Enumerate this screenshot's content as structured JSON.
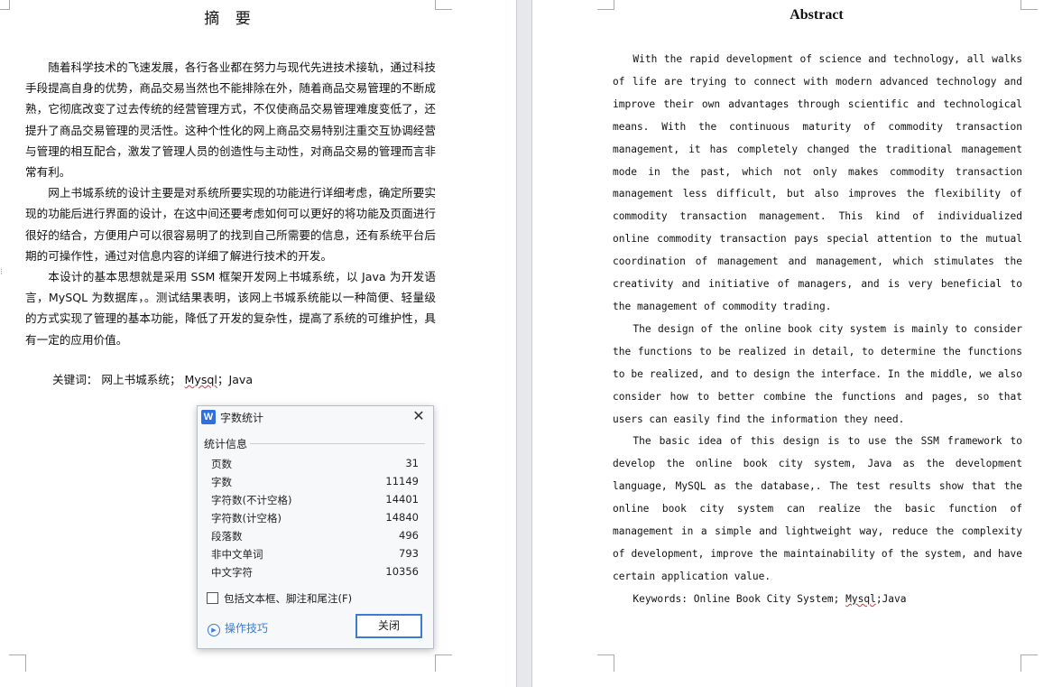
{
  "left_page": {
    "title": "摘  要",
    "paragraphs": [
      "随着科学技术的飞速发展，各行各业都在努力与现代先进技术接轨，通过科技手段提高自身的优势，商品交易当然也不能排除在外，随着商品交易管理的不断成熟，它彻底改变了过去传统的经营管理方式，不仅使商品交易管理难度变低了，还提升了商品交易管理的灵活性。这种个性化的网上商品交易特别注重交互协调经营与管理的相互配合，激发了管理人员的创造性与主动性，对商品交易的管理而言非常有利。",
      "网上书城系统的设计主要是对系统所要实现的功能进行详细考虑，确定所要实现的功能后进行界面的设计，在这中间还要考虑如何可以更好的将功能及页面进行很好的结合，方便用户可以很容易明了的找到自己所需要的信息，还有系统平台后期的可操作性，通过对信息内容的详细了解进行技术的开发。",
      "本设计的基本思想就是采用 SSM 框架开发网上书城系统，以 Java 为开发语言，MySQL 为数据库，。测试结果表明，该网上书城系统能以一种简便、轻量级的方式实现了管理的基本功能，降低了开发的复杂性，提高了系统的可维护性，具有一定的应用价值。"
    ],
    "keywords_label": "关键词：",
    "keywords": [
      "网上书城系统；",
      "Mysql",
      "；Java"
    ]
  },
  "right_page": {
    "title": "Abstract",
    "paragraphs": [
      "With the rapid development of science and technology, all walks of life are trying to connect with modern advanced technology and improve their own advantages through scientific and technological means. With the continuous maturity of commodity transaction management, it has completely changed the traditional management mode in the past, which not only makes commodity transaction management less difficult, but also improves the flexibility of commodity transaction management. This kind of individualized online commodity transaction pays special attention to the mutual coordination of management and management, which stimulates the creativity and initiative of managers, and is very beneficial to the management of commodity trading.",
      "The design of the online book city system is mainly to consider the functions to be realized in detail, to determine the functions to be realized, and to design the interface. In the middle, we also consider how to better combine the functions and pages, so that users can easily find the information they need.",
      "The basic idea of this design is to use the SSM framework to develop the online book city system, Java as the development language, MySQL as the database,. The test results show that the online book city system can realize the basic function of management in a simple and lightweight way, reduce the complexity of development, improve the maintainability of the system, and have certain application value."
    ],
    "keywords_prefix": "Keywords: Online Book City System; ",
    "keywords_mysql": "Mysql",
    "keywords_suffix": ";Java"
  },
  "dialog": {
    "app_icon_letter": "W",
    "title": "字数统计",
    "group_label": "统计信息",
    "stats": [
      {
        "label": "页数",
        "value": "31"
      },
      {
        "label": "字数",
        "value": "11149"
      },
      {
        "label": "字符数(不计空格)",
        "value": "14401"
      },
      {
        "label": "字符数(计空格)",
        "value": "14840"
      },
      {
        "label": "段落数",
        "value": "496"
      },
      {
        "label": "非中文单词",
        "value": "793"
      },
      {
        "label": "中文字符",
        "value": "10356"
      }
    ],
    "checkbox_label": "包括文本框、脚注和尾注(F)",
    "checkbox_checked": false,
    "tips_label": "操作技巧",
    "close_button": "关闭"
  }
}
